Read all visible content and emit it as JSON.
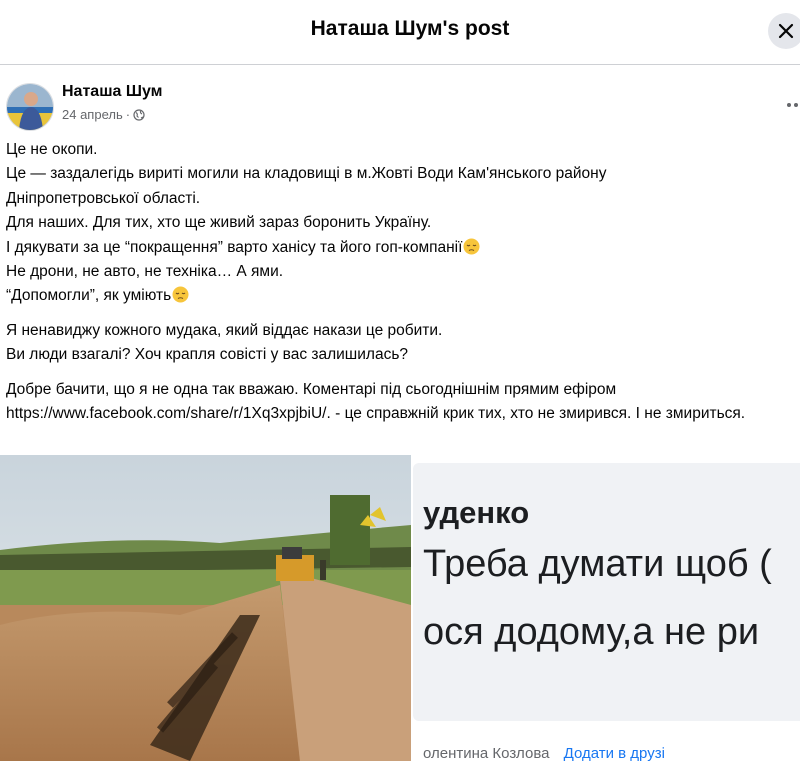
{
  "header": {
    "title": "Наташа Шум's post",
    "close_icon": "close-icon"
  },
  "post": {
    "author": "Наташа Шум",
    "date": "24 апрель",
    "separator": "·",
    "privacy_icon": "globe-icon",
    "more_icon": "more-dots-icon",
    "lines": [
      "Це не окопи.",
      "Це — заздалегідь вириті могили на кладовищі в м.Жовті Води Кам'янського району",
      "Дніпропетровської області.",
      "Для наших. Для тих, хто ще живий зараз боронить Україну.",
      "І дякувати за це “покращення” варто ханісу та його гоп-компанії",
      "Не дрони, не авто, не техніка… А ями.",
      "“Допомогли”, як уміють",
      "Я ненавиджу кожного мудака, який віддає накази це робити.",
      "Ви люди взагалі? Хоч крапля совісті у вас залишилась?",
      "Добре бачити, що я не одна так вважаю. Коментарі під сьогоднішнім прямим ефіром https://www.facebook.com/share/r/1Xq3xpjbiU/. -  це справжній крик тих, хто не змирився. І не змириться."
    ],
    "emoji_icon": "pensive-face-emoji"
  },
  "media": {
    "photo_icon": "cemetery-graves-photo",
    "screenshot": {
      "name": "уденко",
      "line1": "Треба думати щоб (",
      "line2": "ося додому,а не ри",
      "footer": "олентина Козлова",
      "footer_link": "Додати в друзі"
    }
  },
  "colors": {
    "link": "#1877f2",
    "meta": "#65676b",
    "text": "#050505"
  }
}
